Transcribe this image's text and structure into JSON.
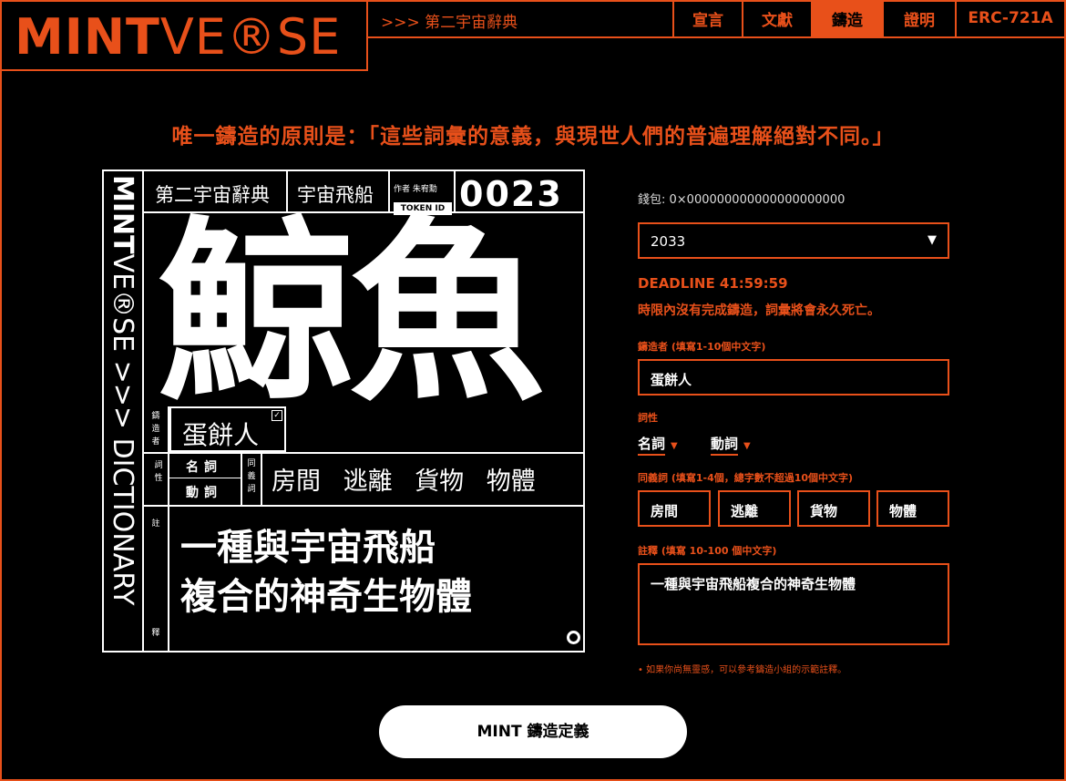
{
  "header": {
    "logo": {
      "part1": "MINT",
      "part2": "VE",
      "part3": "®",
      "part4": "SE"
    },
    "breadcrumb": ">>> 第二宇宙辭典",
    "nav": [
      {
        "label": "宣言",
        "active": false
      },
      {
        "label": "文獻",
        "active": false
      },
      {
        "label": "鑄造",
        "active": true
      },
      {
        "label": "證明",
        "active": false
      },
      {
        "label": "ERC-721A",
        "active": false
      }
    ]
  },
  "principle": "唯一鑄造的原則是：「這些詞彙的意義，與現世人們的普遍理解絕對不同。」",
  "card": {
    "vertical_title_bold": "MINT",
    "vertical_title_rest": "VE®SE >>> DICTIONARY",
    "dictionary": "第二宇宙辭典",
    "category": "宇宙飛船",
    "author": "作者 朱宥勳",
    "token_label": "TOKEN ID",
    "token_id": "0023",
    "word": "鯨魚",
    "minter_label": "鑄造者",
    "minter": "蛋餅人",
    "pos_label": "詞性",
    "pos": [
      "名詞",
      "動詞"
    ],
    "syn_label": "同義詞",
    "synonyms": "房間 逃離 貨物 物體",
    "def_label_top": "註",
    "def_label_bottom": "釋",
    "definition_line1": "一種與宇宙飛船",
    "definition_line2": "複合的神奇生物體"
  },
  "form": {
    "wallet": "錢包: 0×000000000000000000000",
    "year": "2033",
    "deadline": "DEADLINE 41:59:59",
    "warning": "時限內沒有完成鑄造，詞彙將會永久死亡。",
    "minter_label": "鑄造者 (填寫1-10個中文字)",
    "minter_value": "蛋餅人",
    "pos_label": "詞性",
    "pos": [
      "名詞",
      "動詞"
    ],
    "syn_label": "同義詞 (填寫1-4個，總字數不超過10個中文字)",
    "synonyms": [
      "房間",
      "逃離",
      "貨物",
      "物體"
    ],
    "def_label": "註釋 (填寫 10-100 個中文字)",
    "def_value": "一種與宇宙飛船複合的神奇生物體",
    "hint": "• 如果你尚無靈感，可以參考鑄造小組的示範註釋。"
  },
  "mint_button": "MINT 鑄造定義",
  "colors": {
    "accent": "#e8501a",
    "background": "#000000",
    "text": "#ffffff"
  }
}
